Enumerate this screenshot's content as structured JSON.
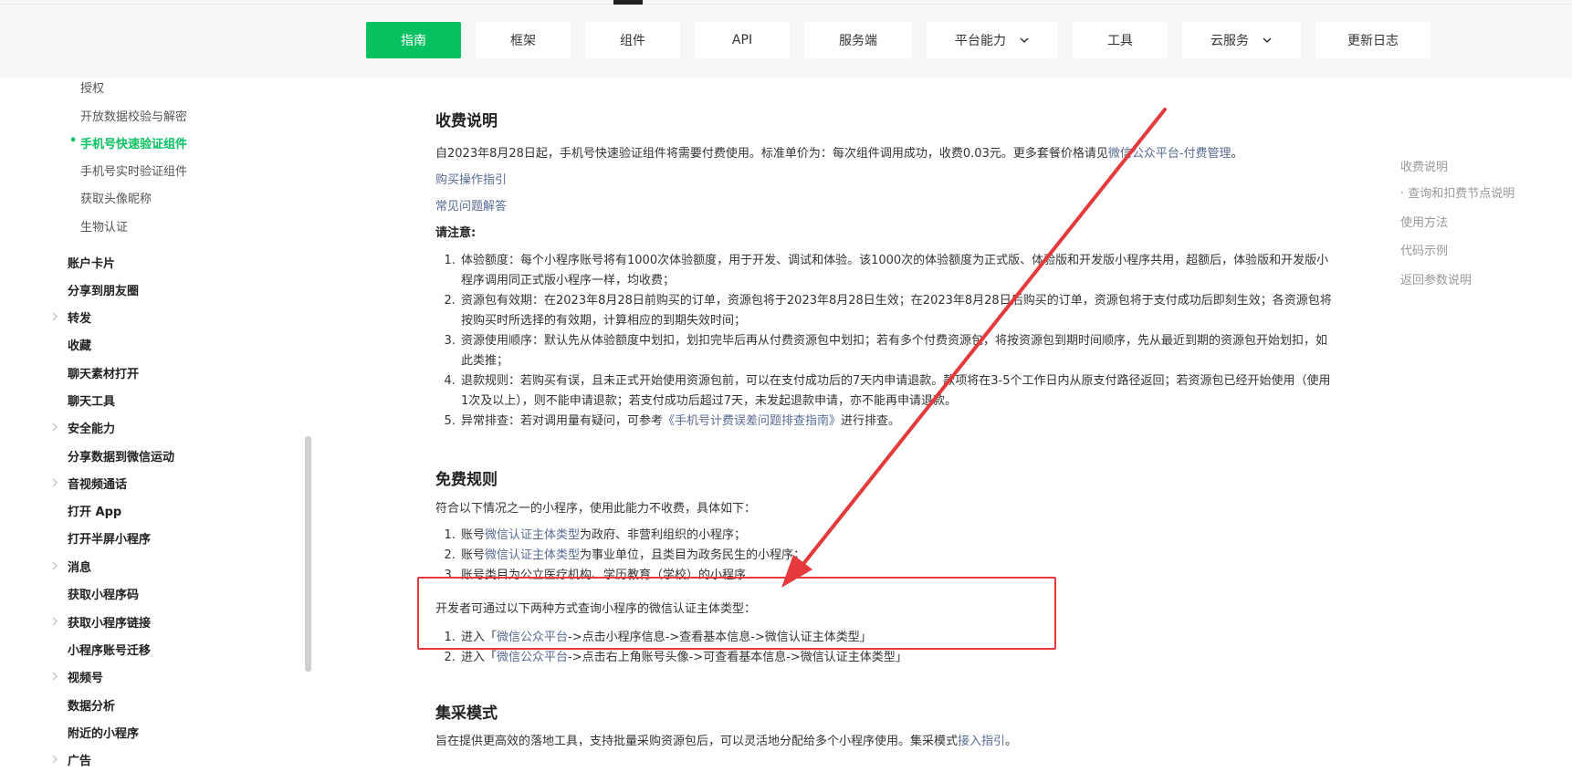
{
  "nav": {
    "tabs": [
      {
        "label": "指南",
        "active": true
      },
      {
        "label": "框架"
      },
      {
        "label": "组件"
      },
      {
        "label": "API"
      },
      {
        "label": "服务端"
      },
      {
        "label": "平台能力",
        "dropdown": true
      },
      {
        "label": "工具"
      },
      {
        "label": "云服务",
        "dropdown": true
      },
      {
        "label": "更新日志"
      }
    ]
  },
  "sidebar": {
    "sub_items": [
      "授权",
      "开放数据校验与解密",
      "手机号快速验证组件",
      "手机号实时验证组件",
      "获取头像昵称",
      "生物认证"
    ],
    "top_items": [
      "账户卡片",
      "分享到朋友圈",
      "转发",
      "收藏",
      "聊天素材打开",
      "聊天工具",
      "安全能力",
      "分享数据到微信运动",
      "音视频通话",
      "打开 App",
      "打开半屏小程序",
      "消息",
      "获取小程序码",
      "获取小程序链接",
      "小程序账号迁移",
      "视频号",
      "数据分析",
      "附近的小程序",
      "广告"
    ]
  },
  "content": {
    "fee_title": "收费说明",
    "fee_intro": "自2023年8月28日起，手机号快速验证组件将需要付费使用。标准单价为：每次组件调用成功，收费0.03元。更多套餐价格请见",
    "fee_link": "微信公众平台-付费管理",
    "fee_end": "。",
    "buy_guide": "购买操作指引",
    "faq": "常见问题解答",
    "note_label": "请注意:",
    "notes": [
      "体验额度：每个小程序账号将有1000次体验额度，用于开发、调试和体验。该1000次的体验额度为正式版、体验版和开发版小程序共用，超额后，体验版和开发版小程序调用同正式版小程序一样，均收费；",
      "资源包有效期：在2023年8月28日前购买的订单，资源包将于2023年8月28日生效；在2023年8月28日后购买的订单，资源包将于支付成功后即刻生效；各资源包将按购买时所选择的有效期，计算相应的到期失效时间；",
      "资源使用顺序：默认先从体验额度中划扣，划扣完毕后再从付费资源包中划扣；若有多个付费资源包，将按资源包到期时间顺序，先从最近到期的资源包开始划扣，如此类推；",
      "退款规则：若购买有误，且未正式开始使用资源包前，可以在支付成功后的7天内申请退款。款项将在3-5个工作日内从原支付路径返回；若资源包已经开始使用（使用1次及以上），则不能申请退款；若支付成功后超过7天，未发起退款申请，亦不能再申请退款。"
    ],
    "note5_pre": "异常排查：若对调用量有疑问，可参考",
    "note5_link": "《手机号计费误差问题排查指南》",
    "note5_post": "进行排查。",
    "free_title": "免费规则",
    "free_intro": "符合以下情况之一的小程序，使用此能力不收费，具体如下：",
    "free1_pre": "账号",
    "free1_link": "微信认证主体类型",
    "free1_post": "为政府、非营利组织的小程序；",
    "free2_pre": "账号",
    "free2_link": "微信认证主体类型",
    "free2_post": "为事业单位，且类目为政务民生的小程序；",
    "free3": "账号类目为公立医疗机构、学历教育（学校）的小程序",
    "dev_intro": "开发者可通过以下两种方式查询小程序的微信认证主体类型：",
    "way1_pre": "进入「",
    "way1_link": "微信公众平台",
    "way1_post": "->点击小程序信息->查看基本信息->微信认证主体类型」",
    "way2_pre": "进入「",
    "way2_link": "微信公众平台",
    "way2_post": "->点击右上角账号头像->可查看基本信息->微信认证主体类型」",
    "collect_title": "集采模式",
    "collect_text": "旨在提供更高效的落地工具，支持批量采购资源包后，可以灵活地分配给多个小程序使用。集采模式",
    "collect_link": "接入指引",
    "collect_end": "。"
  },
  "toc": [
    "收费说明",
    "· 查询和扣费节点说明",
    "使用方法",
    "代码示例",
    "返回参数说明"
  ],
  "colors": {
    "accent": "#07c160",
    "link": "#576b95",
    "annotation": "#e5393c"
  }
}
